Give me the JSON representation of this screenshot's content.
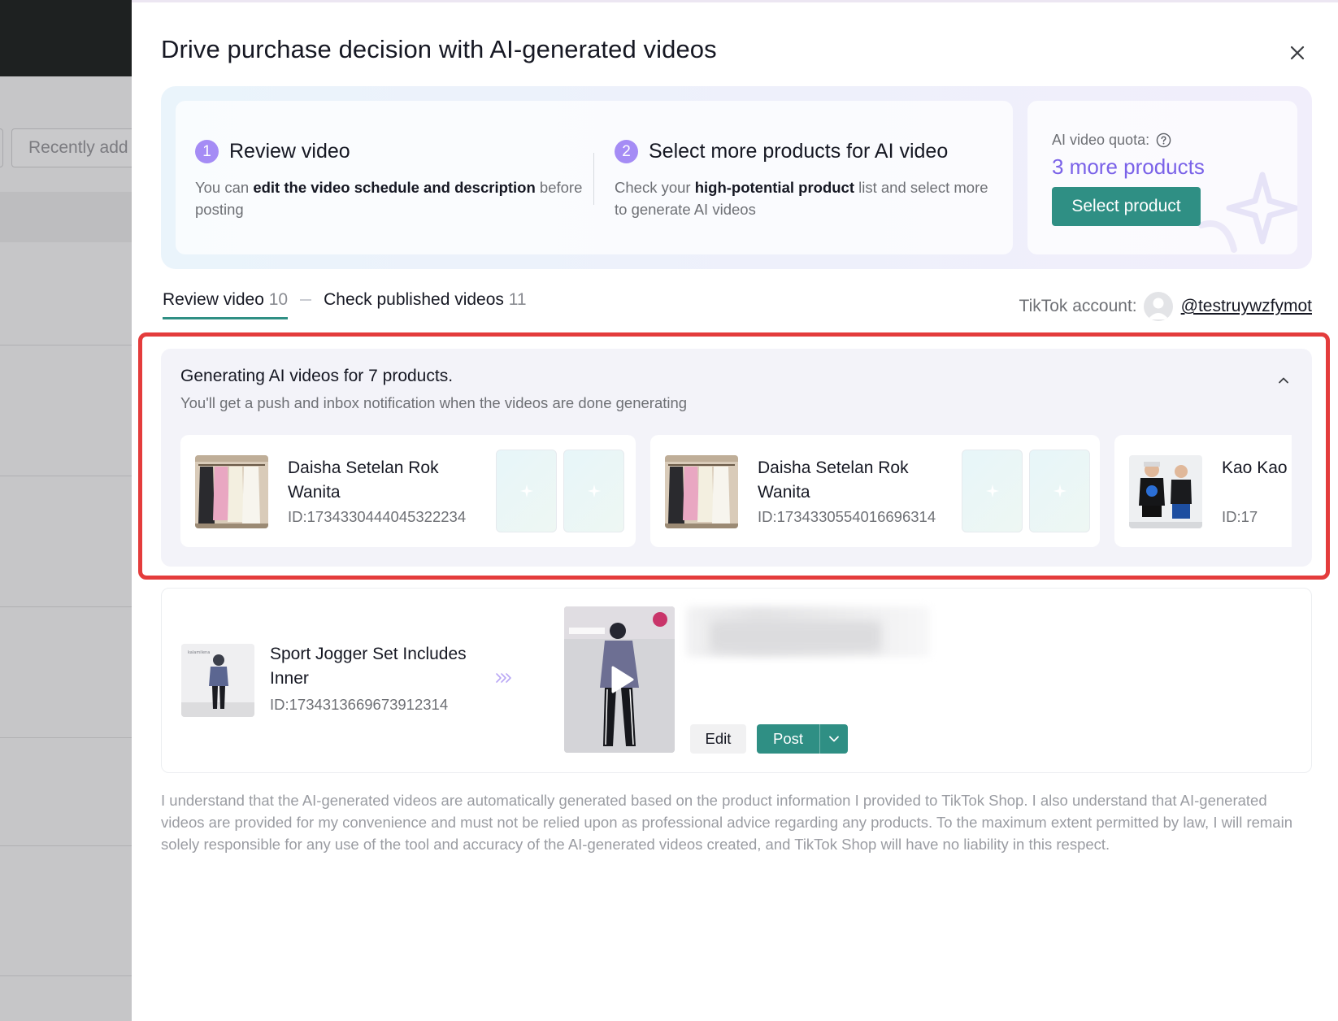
{
  "background": {
    "filter_label": "Recently add"
  },
  "dialog": {
    "title": "Drive purchase decision with AI-generated videos",
    "close_icon": "close-icon"
  },
  "steps": [
    {
      "number": "1",
      "title": "Review video",
      "desc_pre": "You can ",
      "desc_bold": "edit the video schedule and description",
      "desc_post": " before posting"
    },
    {
      "number": "2",
      "title": "Select more products for AI video",
      "desc_pre": "Check your ",
      "desc_bold": "high-potential product",
      "desc_post": " list and select more to generate AI videos"
    }
  ],
  "quota": {
    "label": "AI video quota:",
    "value": "3 more products",
    "button": "Select product"
  },
  "tabs": [
    {
      "label": "Review video",
      "count": "10",
      "active": true
    },
    {
      "label": "Check published videos",
      "count": "11",
      "active": false
    }
  ],
  "account": {
    "label": "TikTok account:",
    "handle": "@testruywzfymot"
  },
  "generating": {
    "title": "Generating AI videos for 7 products.",
    "subtitle": "You'll get a push and inbox notification when the videos are done generating",
    "products": [
      {
        "name": "Daisha Setelan Rok Wanita",
        "id": "ID:1734330444045322234"
      },
      {
        "name": "Daisha Setelan Rok Wanita",
        "id": "ID:1734330554016696314"
      },
      {
        "name": "Kao Kao",
        "id": "ID:17"
      }
    ]
  },
  "review_item": {
    "name": "Sport Jogger Set Includes Inner",
    "id": "ID:1734313669673912314",
    "edit_label": "Edit",
    "post_label": "Post"
  },
  "disclaimer": "I understand that the AI-generated videos are automatically generated based on the product information I provided to TikTok Shop. I also understand that AI-generated videos are provided for my convenience and must not be relied upon as professional advice regarding any products. To the maximum extent permitted by law, I will remain solely responsible for any use of the tool and accuracy of the AI-generated videos created, and TikTok Shop will have no liability in this respect.",
  "colors": {
    "primary": "#2f8f84",
    "accent": "#7a62e8",
    "highlight": "#e43c3c"
  }
}
